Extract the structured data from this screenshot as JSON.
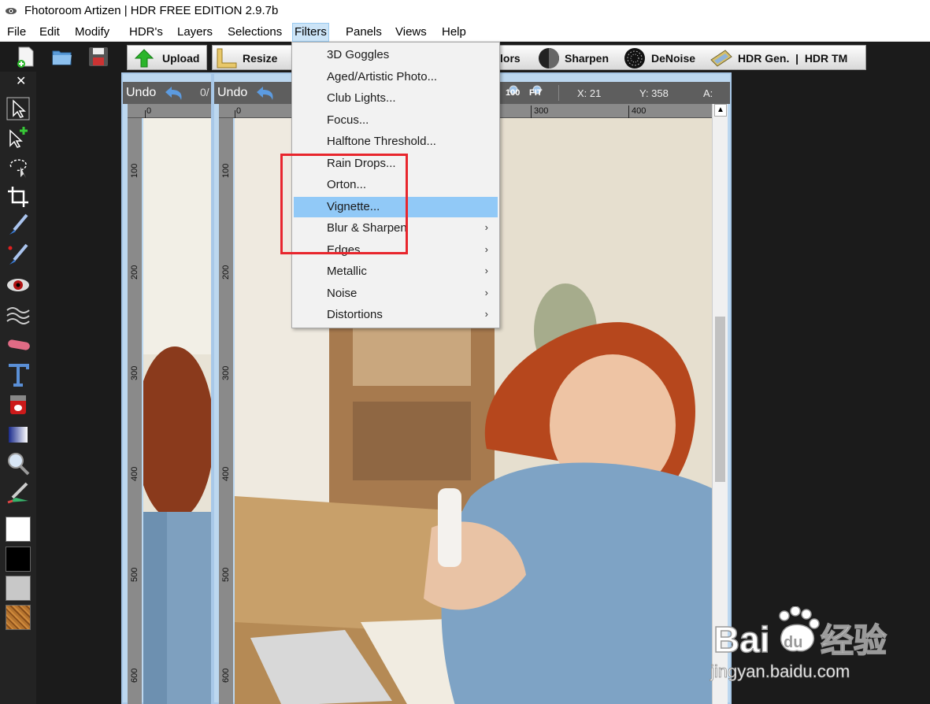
{
  "window": {
    "title": "Fhotoroom Artizen | HDR FREE EDITION 2.9.7b"
  },
  "menubar": {
    "items": [
      "File",
      "Edit",
      "Modify",
      "HDR's",
      "Layers",
      "Selections",
      "Filters",
      "Panels",
      "Views",
      "Help"
    ],
    "active": "Filters"
  },
  "toolbar": {
    "upload": "Upload",
    "resize": "Resize",
    "colors_partial": "lors",
    "sharpen": "Sharpen",
    "denoise": "DeNoise",
    "hdr": "HDR Gen.  |  HDR TM"
  },
  "tools": {
    "close": "✕",
    "swatch_colors": [
      "#ffffff",
      "#000000",
      "#c8c8c8",
      "#b5742f"
    ]
  },
  "docs": {
    "left": {
      "undo": "Undo",
      "counter": "0/"
    },
    "main": {
      "undo": "Undo",
      "zoom": "100",
      "fit": "FIT",
      "x_label": "X: 21",
      "y_label": "Y: 358",
      "a_label": "A:"
    }
  },
  "rulers": {
    "top_left": [
      "0"
    ],
    "top_main": [
      "0",
      "300",
      "400"
    ],
    "left_marks": [
      "100",
      "200",
      "300",
      "400",
      "500",
      "600"
    ]
  },
  "filters_menu": {
    "items": [
      {
        "label": "3D Goggles",
        "submenu": false
      },
      {
        "label": "Aged/Artistic Photo...",
        "submenu": false
      },
      {
        "label": "Club Lights...",
        "submenu": false
      },
      {
        "label": "Focus...",
        "submenu": false
      },
      {
        "label": "Halftone Threshold...",
        "submenu": false
      },
      {
        "label": "Rain Drops...",
        "submenu": false
      },
      {
        "label": "Orton...",
        "submenu": false
      },
      {
        "label": "Vignette...",
        "submenu": false,
        "highlighted": true
      },
      {
        "label": "Blur & Sharpen",
        "submenu": true
      },
      {
        "label": "Edges",
        "submenu": true
      },
      {
        "label": "Metallic",
        "submenu": true
      },
      {
        "label": "Noise",
        "submenu": true
      },
      {
        "label": "Distortions",
        "submenu": true
      }
    ],
    "submenu_arrow": "›"
  },
  "watermark": {
    "brand": "Bai du 经验",
    "url": "jingyan.baidu.com"
  }
}
